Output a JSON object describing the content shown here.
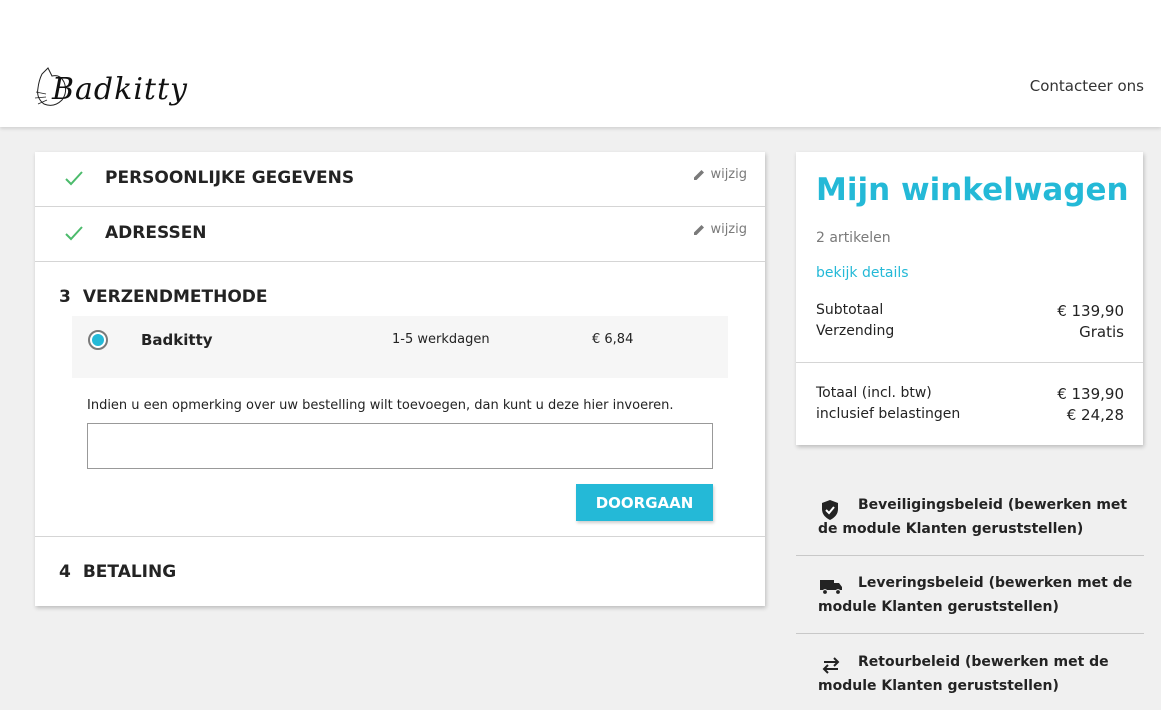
{
  "header": {
    "logo_text": "Badkitty",
    "contact_label": "Contacteer ons"
  },
  "checkout": {
    "steps_done": [
      {
        "title": "PERSOONLIJKE GEGEVENS",
        "edit": "wijzig"
      },
      {
        "title": "ADRESSEN",
        "edit": "wijzig"
      }
    ],
    "shipping": {
      "number": "3",
      "title": "VERZENDMETHODE",
      "carrier": {
        "name": "Badkitty",
        "delay": "1-5 werkdagen",
        "price": "€ 6,84",
        "selected": true
      },
      "comment_label": "Indien u een opmerking over uw bestelling wilt toevoegen, dan kunt u deze hier invoeren.",
      "comment_value": "",
      "continue_label": "DOORGAAN"
    },
    "payment": {
      "number": "4",
      "title": "BETALING"
    }
  },
  "cart": {
    "title": "Mijn winkelwagen",
    "count": "2 artikelen",
    "details_link": "bekijk details",
    "subtotal_label": "Subtotaal",
    "subtotal_value": "€ 139,90",
    "shipping_label": "Verzending",
    "shipping_value": "Gratis",
    "total_label": "Totaal (incl. btw)",
    "total_value": "€ 139,90",
    "tax_label": "inclusief belastingen",
    "tax_value": "€ 24,28"
  },
  "reassurance": [
    {
      "icon": "shield-icon",
      "line1": "Beveiligingsbeleid (bewerken met",
      "line2": "de module Klanten geruststellen)"
    },
    {
      "icon": "truck-icon",
      "line1": "Leveringsbeleid (bewerken met de",
      "line2": "module Klanten geruststellen)"
    },
    {
      "icon": "swap-arrows-icon",
      "line1": "Retourbeleid (bewerken met de",
      "line2": "module Klanten geruststellen)"
    }
  ],
  "colors": {
    "accent": "#24b9d7",
    "check": "#4cbb6c",
    "background": "#f0f0f0"
  }
}
